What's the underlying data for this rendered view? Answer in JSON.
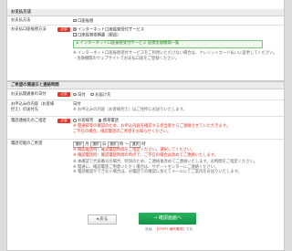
{
  "section1": {
    "title": "お支払方法",
    "rows": [
      {
        "label": "お支払方法",
        "value": "口座振替"
      },
      {
        "label": "お支払口座振替方法",
        "required": "必須",
        "options": [
          "インターネット口座振替受付サービス",
          "口座振替依頼書（郵送）"
        ],
        "green_link": "インターネット口座振替受付サービス 提携金融機関一覧",
        "notes": "※ インターネット口座振替受付サービスをご利用いただけない場合は、クレジットカード払いに変更してください。",
        "notes2": "・金融機関のウェブサイトでお支払口座をご登録ください。"
      }
    ]
  },
  "section2": {
    "title": "ご希望の開通日と連絡時間",
    "rows": [
      {
        "label": "お支払開通後の日付",
        "required": "必須",
        "options": [
          "日付",
          "お届け先"
        ]
      },
      {
        "label": "お申込みの内容（お客様控え）の送付先",
        "line1": "日付",
        "line2": "※ お申込みの内容（お客様控え）はご住所にお送りいたします。"
      },
      {
        "label": "電話連絡先のご指定",
        "required": "必須",
        "options": [
          "お客様宅",
          "携帯電話"
        ],
        "notes": [
          "※ 開通日等の確認のため、お申込内容を確認する担当者からご連絡させていただきます。",
          "ご不在の場合、確認電話のご希望をお知らせください。"
        ]
      },
      {
        "label": "電話可能のご希望",
        "selects": [
          "選択",
          "月",
          "選択",
          "日",
          "選択",
          "時",
          "選択",
          "時"
        ],
        "notes_red": [
          "※ 確認電話時：確認電話時間をご指定ください。選択してください。",
          "※ 確認電話時：確認電話時間の時点で、ご不在の場合は改めてご連絡いたします。"
        ],
        "notes_gray": [
          "※ 本確認で代表番号の場合、時刻のため、ご連絡後改めてご連絡いたします。お時間をご指定ください。",
          "※ 開通に、確認電話ご用意いただく場合は、サポートセンターにご連絡ください。",
          "※ 電話確認ができない場合は、お電話での確認に加えてメールにてご案内をお送りいたします。"
        ]
      }
    ]
  },
  "buttons": {
    "back": "戻る",
    "next": "確認画面へ"
  },
  "footnote": {
    "prefix": "次は、",
    "highlight": "【STEP5 最終確認】",
    "suffix": "です。"
  }
}
